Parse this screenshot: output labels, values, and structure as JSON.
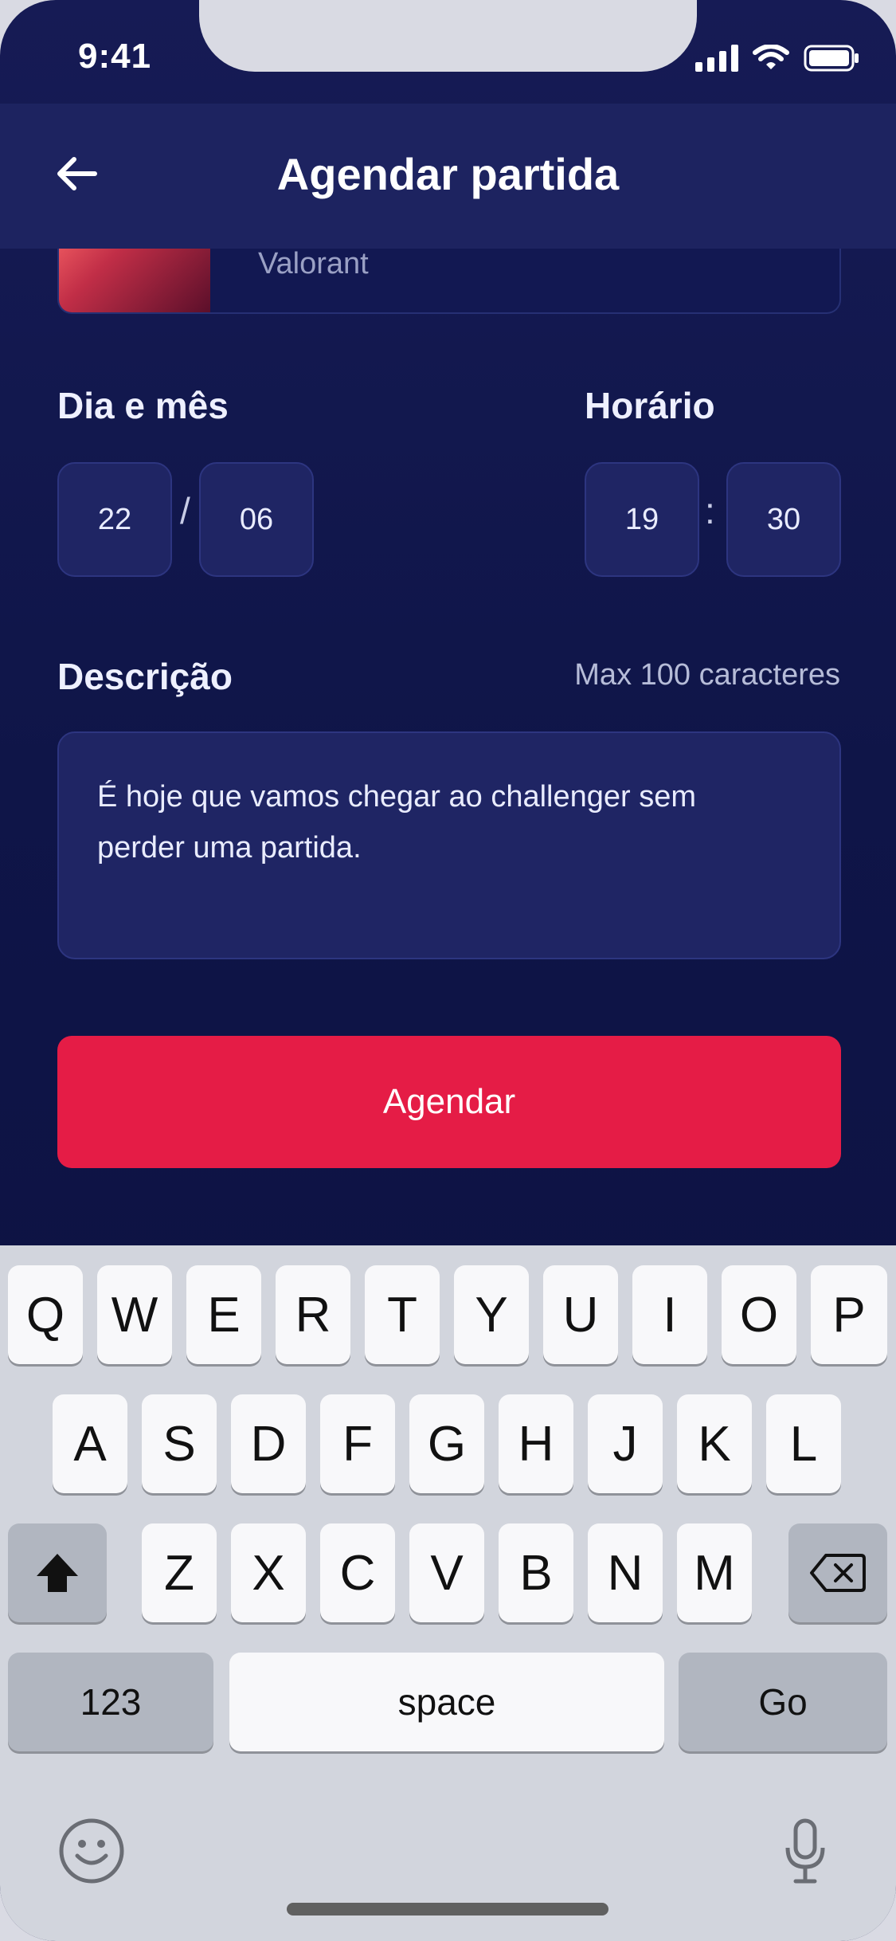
{
  "status_bar": {
    "time": "9:41"
  },
  "header": {
    "title": "Agendar partida"
  },
  "game": {
    "name": "Valorant"
  },
  "form": {
    "date_label": "Dia e mês",
    "day": "22",
    "month": "06",
    "date_sep": "/",
    "time_label": "Horário",
    "hour": "19",
    "minute": "30",
    "time_sep": ":",
    "description_label": "Descrição",
    "description_hint": "Max 100 caracteres",
    "description_value": "É hoje que vamos chegar ao challenger sem perder uma partida."
  },
  "cta": {
    "label": "Agendar"
  },
  "keyboard": {
    "row1": [
      "Q",
      "W",
      "E",
      "R",
      "T",
      "Y",
      "U",
      "I",
      "O",
      "P"
    ],
    "row2": [
      "A",
      "S",
      "D",
      "F",
      "G",
      "H",
      "J",
      "K",
      "L"
    ],
    "row3": [
      "Z",
      "X",
      "C",
      "V",
      "B",
      "N",
      "M"
    ],
    "numbers_label": "123",
    "space_label": "space",
    "go_label": "Go",
    "icons": {
      "shift": "shift-icon",
      "delete": "backspace-icon",
      "emoji": "emoji-icon",
      "mic": "mic-icon"
    }
  }
}
